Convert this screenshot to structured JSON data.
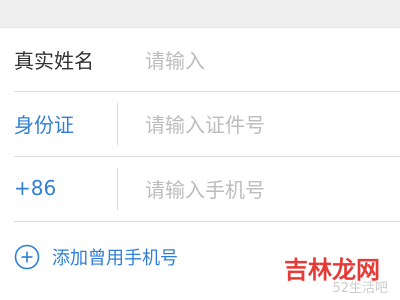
{
  "form": {
    "name_row": {
      "label": "真实姓名",
      "placeholder": "请输入"
    },
    "id_row": {
      "label": "身份证",
      "placeholder": "请输入证件号"
    },
    "phone_row": {
      "label": "+86",
      "placeholder": "请输入手机号"
    }
  },
  "actions": {
    "add_phone_label": "添加曾用手机号"
  },
  "watermark": {
    "text": "吉林龙网",
    "sub_text": "52生活吧"
  },
  "colors": {
    "accent": "#2f7fd6",
    "placeholder": "#bdbdbd",
    "label": "#333333",
    "watermark": "#e63a37"
  },
  "icons": {
    "add": "plus-circle-icon"
  }
}
